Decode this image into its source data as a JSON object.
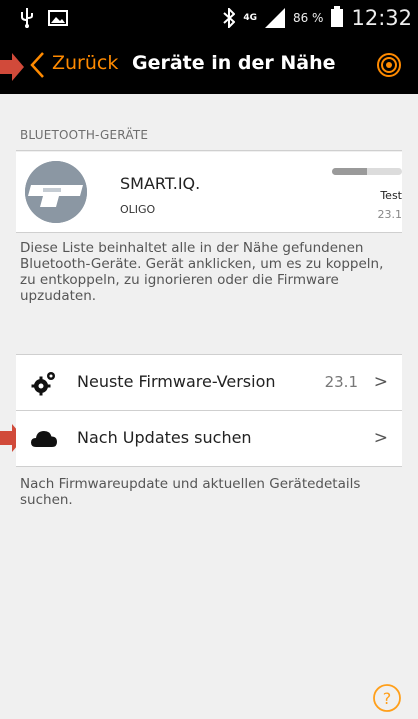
{
  "status_bar": {
    "network": "4G",
    "battery_pct": "86 %",
    "time": "12:32",
    "icons": [
      "usb-icon",
      "image-icon",
      "bluetooth-icon",
      "signal-icon",
      "battery-icon"
    ]
  },
  "header": {
    "back_label": "Zurück",
    "title": "Geräte in der Nähe",
    "accent_color": "#ff8a00"
  },
  "section": {
    "header": "BLUETOOTH-GERÄTE"
  },
  "device": {
    "name": "SMART.IQ.",
    "subtitle": "OLIGO",
    "status": "Test",
    "version": "23.1",
    "progress": 0.5
  },
  "description": "Diese Liste beinhaltet alle in der Nähe gefundenen Bluetooth-Geräte. Gerät anklicken, um es zu koppeln, zu entkoppeln, zu ignorieren oder die Firmware upzudaten.",
  "rows": [
    {
      "label": "Neuste Firmware-Version",
      "value": "23.1",
      "icon": "gears-icon"
    },
    {
      "label": "Nach Updates suchen",
      "value": "",
      "icon": "cloud-icon"
    }
  ],
  "footer_text": "Nach Firmwareupdate und aktuellen Gerätedetails suchen.",
  "chevron": ">"
}
